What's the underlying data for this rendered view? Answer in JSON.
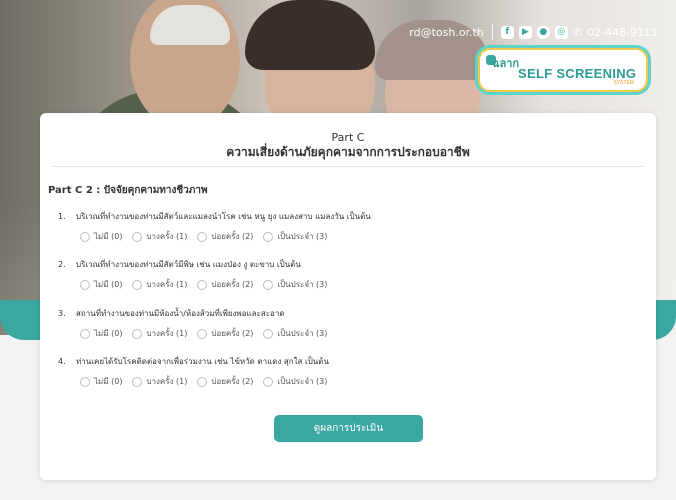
{
  "header": {
    "email": "rd@tosh.or.th",
    "phone": "02-448-9111",
    "social_icons": [
      "facebook-icon",
      "youtube-icon",
      "line-icon",
      "instagram-icon",
      "phone-icon"
    ],
    "logo": {
      "thai": "ฉลาก",
      "main": "SELF SCREENING",
      "small": "SYSTEM"
    }
  },
  "card": {
    "title": "Part C",
    "subtitle": "ความเสี่ยงด้านภัยคุกคามจากการประกอบอาชีพ",
    "section_title": "Part C 2 : ปัจจัยคุกคามทางชีวภาพ",
    "questions": [
      {
        "num": "1.",
        "text": "บริเวณที่ทำงานของท่านมีสัตว์และแมลงนำโรค เช่น หนู ยุง แมลงสาบ แมลงวัน เป็นต้น"
      },
      {
        "num": "2.",
        "text": "บริเวณที่ทำงานของท่านมีสัตว์มีพิษ เช่น แมงป่อง งู ตะขาบ เป็นต้น"
      },
      {
        "num": "3.",
        "text": "สถานที่ทำงานของท่านมีห้องน้ำ/ห้องส้วมที่เพียงพอและสะอาด"
      },
      {
        "num": "4.",
        "text": "ท่านเคยได้รับโรคติดต่อจากเพื่อร่วมงาน เช่น ไข้หวัด ตาแดง สุกใส เป็นต้น"
      }
    ],
    "options": [
      "ไม่มี (0)",
      "บางครั้ง (1)",
      "บ่อยครั้ง (2)",
      "เป็นประจำ (3)"
    ],
    "submit_label": "ดูผลการประเมิน"
  },
  "colors": {
    "accent": "#3aa7a1",
    "logo_border": "#f2c84c"
  }
}
